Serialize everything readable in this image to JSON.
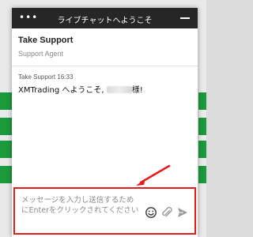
{
  "window": {
    "title": "ライブチャットへようこそ",
    "menu_icon": "ellipsis-icon",
    "minimize_icon": "minimize-icon"
  },
  "agent": {
    "name": "Take Support",
    "role": "Support Agent"
  },
  "messages": [
    {
      "sender": "Take Support",
      "time": "16:33",
      "text_before": "XMTrading へようこそ, ",
      "text_after": "様!"
    }
  ],
  "composer": {
    "placeholder": "メッセージを入力し送信するためにEnterをクリックされてください",
    "emoji_icon": "emoji-icon",
    "attach_icon": "paperclip-icon",
    "send_icon": "send-icon"
  },
  "colors": {
    "topbar": "#262626",
    "highlight": "#e61b1b",
    "background_green": "#1a9a3a"
  }
}
